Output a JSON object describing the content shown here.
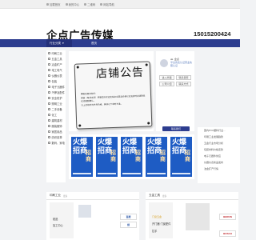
{
  "topbar": {
    "links": [
      {
        "label": "加载首页",
        "icon": "home-icon"
      },
      {
        "label": "我的中心",
        "icon": "user-icon"
      },
      {
        "label": "二维码",
        "icon": "qrcode-icon"
      },
      {
        "label": "网站导航",
        "icon": "sitemap-icon"
      }
    ]
  },
  "header": {
    "logo": "企点广告传媒",
    "phone": "15015200424"
  },
  "nav": {
    "category_label": "行业分类",
    "items": [
      "首页"
    ]
  },
  "sidebar": {
    "items": [
      "印刷工业",
      "五金工具",
      "冶金矿产",
      "电工电气",
      "仪器仪表",
      "包装",
      "电子元器件",
      "汽摩及配件",
      "安全防护",
      "照明工业",
      "二手设备",
      "化工",
      "建筑建材",
      "服装服饰",
      "家居用品",
      "纺织皮革",
      "数码、家电"
    ]
  },
  "banner": {
    "title": "店铺公告",
    "heading": "尊敬的朋友您好：",
    "paragraphs": [
      "感谢（每月会员）顾客您好欢迎光临本店商品价格以及发货时间请联系在线客服确认。",
      "以上价格均为参考价格，具体以下单时为准。"
    ]
  },
  "company": {
    "name": "ok. 企点",
    "desc": "平台实名认证营业执照认证",
    "buttons": [
      "进入商铺",
      "联系卖家",
      "公司介绍",
      "联系方式"
    ],
    "contact": "联系我们"
  },
  "news": {
    "items": [
      "国内PVC塑料行业...",
      "印刷工业发展趋势",
      "五金行业市场分析",
      "包装材料价格走势",
      "电子元器件供应",
      "仪器仪表新品发布",
      "冶金矿产行情"
    ]
  },
  "posters": [
    {
      "title": "火爆招商",
      "side": "招商"
    },
    {
      "title": "火爆招商",
      "side": "招商"
    },
    {
      "title": "火爆招商",
      "side": "招商"
    },
    {
      "title": "火爆招商",
      "side": "招商"
    },
    {
      "title": "火爆招商",
      "side": "招商"
    }
  ],
  "panels": [
    {
      "title": "印刷工业",
      "more": "更多",
      "left_items": [
        "纸品",
        "加工中心"
      ],
      "brands": [
        "百度",
        "创"
      ]
    },
    {
      "title": "五金工具",
      "more": "更多",
      "left_items": [
        "门窗五金",
        "开门器·门窗配件",
        "拉手"
      ],
      "brands": [
        "BERON",
        "BOSCH"
      ]
    }
  ],
  "colors": {
    "nav": "#2d3d8f",
    "poster": "#1e5cc4",
    "accent": "#d8a020"
  }
}
